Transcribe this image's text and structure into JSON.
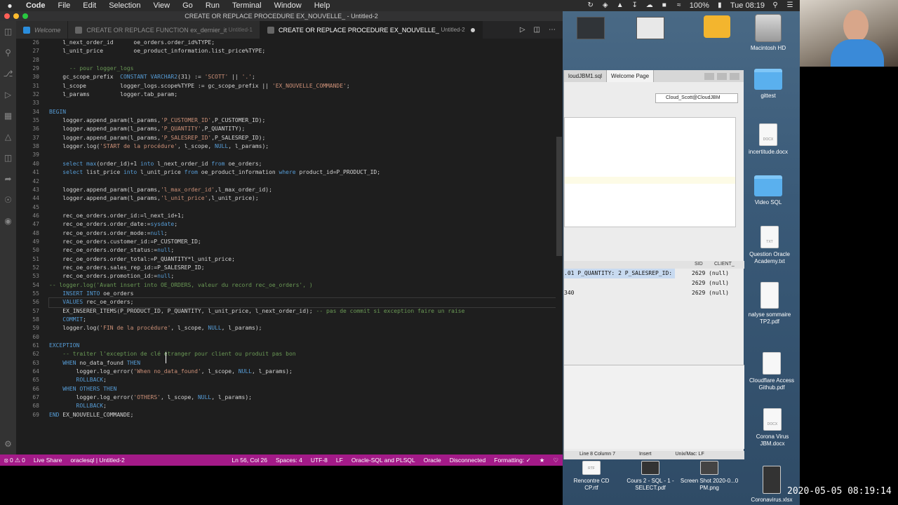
{
  "menubar": {
    "apple": "",
    "items": [
      "Code",
      "File",
      "Edit",
      "Selection",
      "View",
      "Go",
      "Run",
      "Terminal",
      "Window",
      "Help"
    ],
    "battery": "100%",
    "clock": "Tue 08:19"
  },
  "vscode": {
    "title": "CREATE OR REPLACE PROCEDURE EX_NOUVELLE_ - Untitled-2",
    "tabs": [
      {
        "label": "Welcome",
        "meta": ""
      },
      {
        "label": "CREATE OR REPLACE FUNCTION ex_dernier_it",
        "meta": "Untitled-1"
      },
      {
        "label": "CREATE OR REPLACE PROCEDURE EX_NOUVELLE_",
        "meta": "Untitled-2"
      }
    ],
    "code_lines": [
      {
        "n": "26",
        "t": "    l_next_order_id      oe_orders.order_id%TYPE;"
      },
      {
        "n": "27",
        "t": "    l_unit_price         oe_product_information.list_price%TYPE;"
      },
      {
        "n": "28",
        "t": ""
      },
      {
        "n": "29",
        "t": "      -- pour logger_logs"
      },
      {
        "n": "30",
        "t": "    gc_scope_prefix  CONSTANT VARCHAR2(31) := 'SCOTT' || '.';"
      },
      {
        "n": "31",
        "t": "    l_scope          logger_logs.scope%TYPE := gc_scope_prefix || 'EX_NOUVELLE_COMMANDE';"
      },
      {
        "n": "32",
        "t": "    l_params         logger.tab_param;"
      },
      {
        "n": "33",
        "t": ""
      },
      {
        "n": "34",
        "t": "BEGIN"
      },
      {
        "n": "35",
        "t": "    logger.append_param(l_params,'P_CUSTOMER_ID',P_CUSTOMER_ID);"
      },
      {
        "n": "36",
        "t": "    logger.append_param(l_params,'P_QUANTITY',P_QUANTITY);"
      },
      {
        "n": "37",
        "t": "    logger.append_param(l_params,'P_SALESREP_ID',P_SALESREP_ID);"
      },
      {
        "n": "38",
        "t": "    logger.log('START de la procédure', l_scope, NULL, l_params);"
      },
      {
        "n": "39",
        "t": ""
      },
      {
        "n": "40",
        "t": "    select max(order_id)+1 into l_next_order_id from oe_orders;"
      },
      {
        "n": "41",
        "t": "    select list_price into l_unit_price from oe_product_information where product_id=P_PRODUCT_ID;"
      },
      {
        "n": "42",
        "t": ""
      },
      {
        "n": "43",
        "t": "    logger.append_param(l_params,'l_max_order_id',l_max_order_id);"
      },
      {
        "n": "44",
        "t": "    logger.append_param(l_params,'l_unit_price',l_unit_price);"
      },
      {
        "n": "45",
        "t": ""
      },
      {
        "n": "46",
        "t": "    rec_oe_orders.order_id:=l_next_id+1;"
      },
      {
        "n": "47",
        "t": "    rec_oe_orders.order_date:=sysdate;"
      },
      {
        "n": "48",
        "t": "    rec_oe_orders.order_mode:=null;"
      },
      {
        "n": "49",
        "t": "    rec_oe_orders.customer_id:=P_CUSTOMER_ID;"
      },
      {
        "n": "50",
        "t": "    rec_oe_orders.order_status:=null;"
      },
      {
        "n": "51",
        "t": "    rec_oe_orders.order_total:=P_QUANTITY*l_unit_price;"
      },
      {
        "n": "52",
        "t": "    rec_oe_orders.sales_rep_id:=P_SALESREP_ID;"
      },
      {
        "n": "53",
        "t": "    rec_oe_orders.promotion_id:=null;"
      },
      {
        "n": "54",
        "t": "-- logger.log('Avant insert into OE_ORDERS, valeur du record rec_oe_orders', )"
      },
      {
        "n": "55",
        "t": "    INSERT INTO oe_orders"
      },
      {
        "n": "56",
        "t": "    VALUES rec_oe_orders;"
      },
      {
        "n": "57",
        "t": "    EX_INSERER_ITEMS(P_PRODUCT_ID, P_QUANTITY, l_unit_price, l_next_order_id); -- pas de commit si exception faire un raise"
      },
      {
        "n": "58",
        "t": "    COMMIT;"
      },
      {
        "n": "59",
        "t": "    logger.log('FIN de la procédure', l_scope, NULL, l_params);"
      },
      {
        "n": "60",
        "t": ""
      },
      {
        "n": "61",
        "t": "EXCEPTION"
      },
      {
        "n": "62",
        "t": "    -- traiter l'exception de clé étranger pour client ou produit pas bon"
      },
      {
        "n": "63",
        "t": "    WHEN no_data_found THEN"
      },
      {
        "n": "64",
        "t": "        logger.log_error('When no_data_found', l_scope, NULL, l_params);"
      },
      {
        "n": "65",
        "t": "        ROLLBACK;"
      },
      {
        "n": "66",
        "t": "    WHEN OTHERS THEN"
      },
      {
        "n": "67",
        "t": "        logger.log_error('OTHERS', l_scope, NULL, l_params);"
      },
      {
        "n": "68",
        "t": "        ROLLBACK;"
      },
      {
        "n": "69",
        "t": "END EX_NOUVELLE_COMMANDE;"
      }
    ],
    "status": {
      "problems": "⦻ 0 ⚠ 0",
      "live_share": "Live Share",
      "connection": "oraclesql | Untitled-2",
      "cursor": "Ln 56, Col 26",
      "spaces": "Spaces: 4",
      "encoding": "UTF-8",
      "eol": "LF",
      "language": "Oracle-SQL and PLSQL",
      "oracle": "Oracle",
      "disconnected": "Disconnected",
      "formatting": "Formatting: ✓"
    }
  },
  "sqldev": {
    "tabs": [
      "loudJBM1.sql",
      "Welcome Page"
    ],
    "connection": "Cloud_Scott@CloudJBM",
    "result_headers": [
      "SID",
      "CLIENT_"
    ],
    "results": [
      {
        "c1": ".01 P_QUANTITY: 2 P_SALESREP_ID:",
        "c2": "2629 (null)"
      },
      {
        "c1": "",
        "c2": "2629 (null)"
      },
      {
        "c1": "340",
        "c2": "2629 (null)"
      }
    ],
    "status": [
      "Line 8 Column 7",
      "Insert",
      "Unix/Mac: LF"
    ]
  },
  "desktop": {
    "icons": [
      {
        "label": "Macintosh HD"
      },
      {
        "label": "gittest"
      },
      {
        "label": "incertitude.docx"
      },
      {
        "label": "Video SQL"
      },
      {
        "label": "Question Oracle Academy.txt"
      },
      {
        "label": "nalyse sommaire TP2.pdf"
      },
      {
        "label": "Cloudflare Access Github.pdf"
      },
      {
        "label": "Corona Virus JBM.docx"
      },
      {
        "label": "Rencontre CD CP.rtf"
      },
      {
        "label": "Cours 2 - SQL - 1 - SELECT.pdf"
      },
      {
        "label": "Screen Shot 2020-0...0 PM.png"
      },
      {
        "label": "Coronavirus.xlsx"
      }
    ]
  },
  "overlay": {
    "timestamp": "2020-05-05 08:19:14"
  }
}
